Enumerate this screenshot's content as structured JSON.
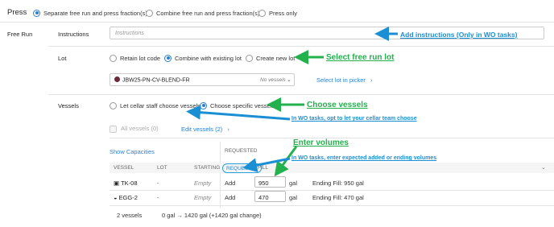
{
  "press": {
    "title": "Press",
    "options": [
      {
        "label": "Separate free run and press fraction(s)",
        "selected": true
      },
      {
        "label": "Combine free run and press fraction(s)",
        "selected": false
      },
      {
        "label": "Press only",
        "selected": false
      }
    ]
  },
  "free_run": {
    "section_label": "Free Run",
    "instructions": {
      "label": "Instructions",
      "placeholder": "Instructions"
    },
    "lot": {
      "label": "Lot",
      "options": [
        {
          "label": "Retain lot code",
          "selected": false
        },
        {
          "label": "Combine with existing lot",
          "selected": true
        },
        {
          "label": "Create new lot",
          "selected": false
        }
      ],
      "selected_lot": "JBW25-PN-CV-BLEND-FR",
      "vessels_note": "No vessels",
      "picker_link": "Select lot in picker"
    },
    "vessels": {
      "label": "Vessels",
      "options": [
        {
          "label": "Let cellar staff choose vessels",
          "selected": false
        },
        {
          "label": "Choose specific vessels",
          "selected": true
        }
      ],
      "all_vessels": "All vessels (0)",
      "edit_vessels": "Edit vessels (2)",
      "show_capacities": "Show Capacities",
      "requested_header": "REQUESTED",
      "columns": [
        "VESSEL",
        "LOT",
        "STARTING",
        "REQUEST",
        "FILL"
      ],
      "rows": [
        {
          "vessel": "TK-08",
          "lot": "-",
          "starting": "Empty",
          "request": "Add",
          "fill": "950",
          "unit": "gal",
          "ending": "Ending Fill: 950 gal"
        },
        {
          "vessel": "EGG-2",
          "lot": "-",
          "starting": "Empty",
          "request": "Add",
          "fill": "470",
          "unit": "gal",
          "ending": "Ending Fill: 470 gal"
        }
      ],
      "footer_count": "2 vessels",
      "footer_change": "0 gal → 1420 gal (+1420 gal change)"
    }
  },
  "annotations": {
    "instructions": "Add instructions (Only in WO tasks)",
    "lot": "Select free run lot",
    "vessels": "Choose vessels",
    "wo_cellar": "In WO tasks, opt to let your cellar team choose",
    "volumes": "Enter volumes",
    "wo_volumes": "In WO tasks, enter expected added or ending volumes"
  },
  "colors": {
    "accent": "#2a7fd4",
    "annotation_green": "#22b14c",
    "annotation_blue": "#1a8fd4"
  }
}
